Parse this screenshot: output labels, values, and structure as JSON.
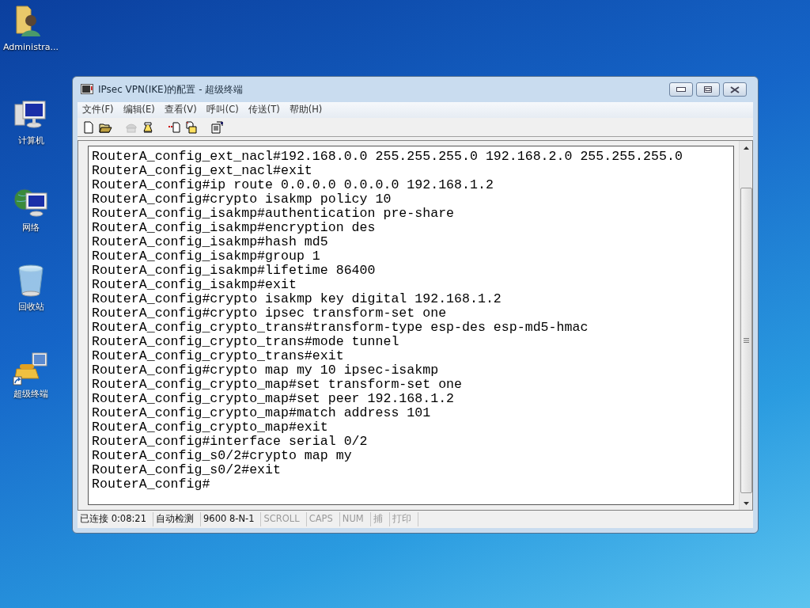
{
  "desktop_icons": [
    {
      "kind": "user-folder",
      "label": "Administra..."
    },
    {
      "kind": "computer",
      "label": "计算机"
    },
    {
      "kind": "network",
      "label": "网络"
    },
    {
      "kind": "recycle-bin",
      "label": "回收站"
    },
    {
      "kind": "terminal-shortcut",
      "label": "超级终端"
    }
  ],
  "window": {
    "title": "IPsec VPN(IKE)的配置 - 超级终端"
  },
  "menu": [
    "文件(F)",
    "编辑(E)",
    "查看(V)",
    "呼叫(C)",
    "传送(T)",
    "帮助(H)"
  ],
  "toolbar": [
    {
      "kind": "new",
      "disabled": false
    },
    {
      "kind": "open",
      "disabled": false
    },
    {
      "kind": "call",
      "disabled": true
    },
    {
      "kind": "hangup",
      "disabled": false
    },
    {
      "kind": "send",
      "disabled": false
    },
    {
      "kind": "receive",
      "disabled": false
    },
    {
      "kind": "properties",
      "disabled": false
    }
  ],
  "terminal_lines": [
    "RouterA_config_ext_nacl#192.168.0.0 255.255.255.0 192.168.2.0 255.255.255.0",
    "RouterA_config_ext_nacl#exit",
    "RouterA_config#ip route 0.0.0.0 0.0.0.0 192.168.1.2",
    "RouterA_config#crypto isakmp policy 10",
    "RouterA_config_isakmp#authentication pre-share",
    "RouterA_config_isakmp#encryption des",
    "RouterA_config_isakmp#hash md5",
    "RouterA_config_isakmp#group 1",
    "RouterA_config_isakmp#lifetime 86400",
    "RouterA_config_isakmp#exit",
    "RouterA_config#crypto isakmp key digital 192.168.1.2",
    "RouterA_config#crypto ipsec transform-set one",
    "RouterA_config_crypto_trans#transform-type esp-des esp-md5-hmac",
    "RouterA_config_crypto_trans#mode tunnel",
    "RouterA_config_crypto_trans#exit",
    "RouterA_config#crypto map my 10 ipsec-isakmp",
    "RouterA_config_crypto_map#set transform-set one",
    "RouterA_config_crypto_map#set peer 192.168.1.2",
    "RouterA_config_crypto_map#match address 101",
    "RouterA_config_crypto_map#exit",
    "RouterA_config#interface serial 0/2",
    "RouterA_config_s0/2#crypto map my",
    "RouterA_config_s0/2#exit",
    "RouterA_config#"
  ],
  "status_bar": [
    {
      "text": "已连接 0:08:21",
      "disabled": false
    },
    {
      "text": "自动检测",
      "disabled": false
    },
    {
      "text": "9600 8-N-1",
      "disabled": false
    },
    {
      "text": "SCROLL",
      "disabled": true
    },
    {
      "text": "CAPS",
      "disabled": true
    },
    {
      "text": "NUM",
      "disabled": true
    },
    {
      "text": "捕",
      "disabled": true
    },
    {
      "text": "打印",
      "disabled": true
    }
  ]
}
